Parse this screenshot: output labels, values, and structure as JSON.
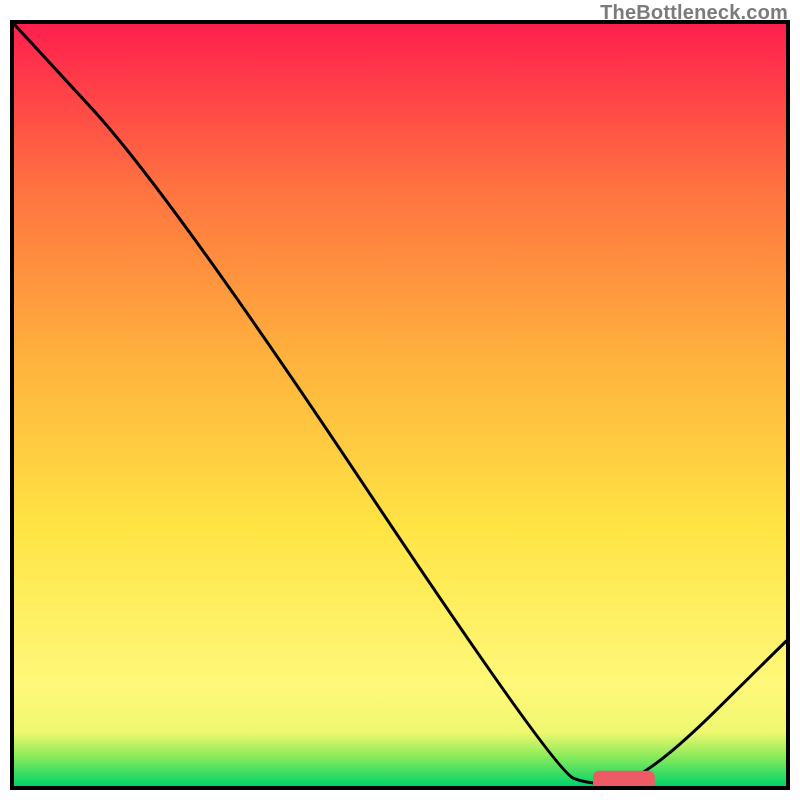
{
  "watermark": "TheBottleneck.com",
  "chart_data": {
    "type": "line",
    "title": "",
    "xlabel": "",
    "ylabel": "",
    "xlim": [
      0,
      100
    ],
    "ylim": [
      0,
      100
    ],
    "grid": false,
    "series": [
      {
        "name": "bottleneck-curve",
        "color": "#000000",
        "x": [
          0,
          20,
          70,
          75,
          82,
          100
        ],
        "values": [
          100,
          78,
          2,
          0,
          1,
          19
        ]
      }
    ],
    "markers": [
      {
        "name": "optimal-range-marker",
        "color": "#ef5b65",
        "x_start": 75,
        "x_end": 83,
        "y": 0.5,
        "thickness": 3
      }
    ],
    "gradient_stops": [
      {
        "offset": 0,
        "color": "#00d36a"
      },
      {
        "offset": 4,
        "color": "#8eeb5a"
      },
      {
        "offset": 7,
        "color": "#eef86f"
      },
      {
        "offset": 13,
        "color": "#fff87a"
      },
      {
        "offset": 34,
        "color": "#ffe444"
      },
      {
        "offset": 56,
        "color": "#ffb23d"
      },
      {
        "offset": 78,
        "color": "#ff7440"
      },
      {
        "offset": 100,
        "color": "#ff1f4e"
      }
    ]
  }
}
